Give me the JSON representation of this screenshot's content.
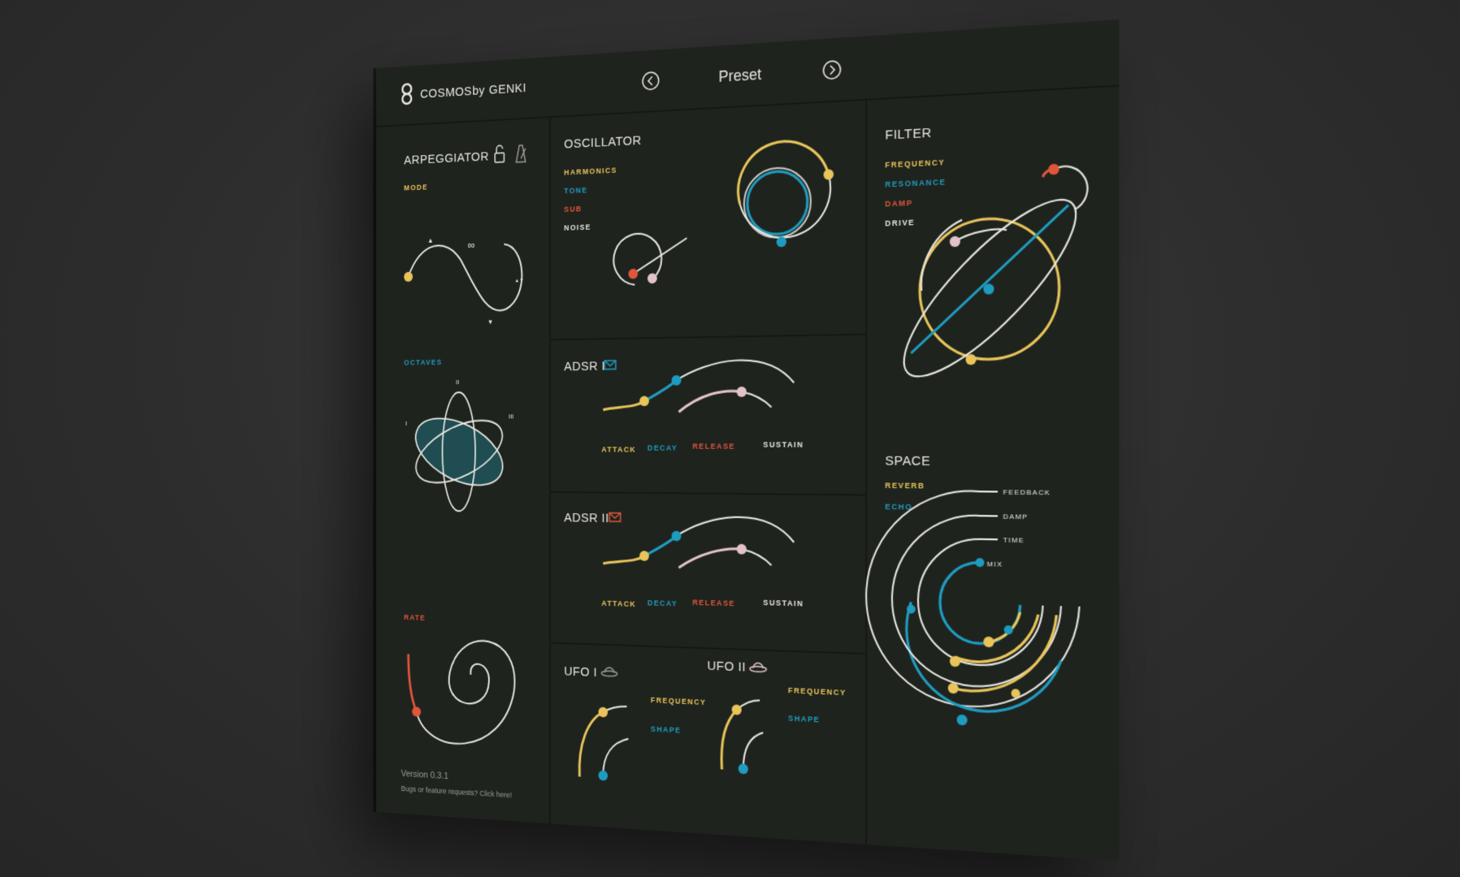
{
  "app": {
    "logo_icon": "infinity-logo-icon",
    "name": "COSMOS",
    "by": "by",
    "brand": "GENKI",
    "preset_label": "Preset",
    "version": "Version 0.3.1",
    "feedback_link": "Bugs or feature requests? Click here!"
  },
  "colors": {
    "background": "#1f231e",
    "yellow": "#e8c45a",
    "blue": "#1e9cc0",
    "red": "#e0563a",
    "white": "#e8e8e2",
    "pink": "#e3c4c6",
    "teal_fill": "#1f4d52"
  },
  "arpeggiator": {
    "title": "ARPEGGIATOR",
    "lock_icon": "lock-icon",
    "metronome_icon": "metronome-icon",
    "mode_label": "MODE",
    "mode_symbols": [
      "▲",
      "∞",
      "▼",
      "▲▼"
    ],
    "octaves_label": "OCTAVES",
    "octave_marks": [
      "I",
      "II",
      "III"
    ],
    "rate_label": "RATE"
  },
  "oscillator": {
    "title": "OSCILLATOR",
    "params": [
      "HARMONICS",
      "TONE",
      "SUB",
      "NOISE"
    ]
  },
  "filter": {
    "title": "FILTER",
    "params": [
      "FREQUENCY",
      "RESONANCE",
      "DAMP",
      "DRIVE"
    ]
  },
  "adsr1": {
    "title": "ADSR I",
    "envelope_icon": "envelope-icon",
    "params": [
      "ATTACK",
      "DECAY",
      "RELEASE",
      "SUSTAIN"
    ]
  },
  "adsr2": {
    "title": "ADSR II",
    "envelope_icon": "envelope-icon",
    "params": [
      "ATTACK",
      "DECAY",
      "RELEASE",
      "SUSTAIN"
    ]
  },
  "space": {
    "title": "SPACE",
    "params": [
      "REVERB",
      "ECHO"
    ],
    "ring_labels": [
      "FEEDBACK",
      "DAMP",
      "TIME",
      "MIX"
    ]
  },
  "ufo1": {
    "title": "UFO I",
    "ufo_icon": "ufo-icon",
    "params": [
      "FREQUENCY",
      "SHAPE"
    ]
  },
  "ufo2": {
    "title": "UFO II",
    "ufo_icon": "ufo-icon",
    "params": [
      "FREQUENCY",
      "SHAPE"
    ]
  }
}
